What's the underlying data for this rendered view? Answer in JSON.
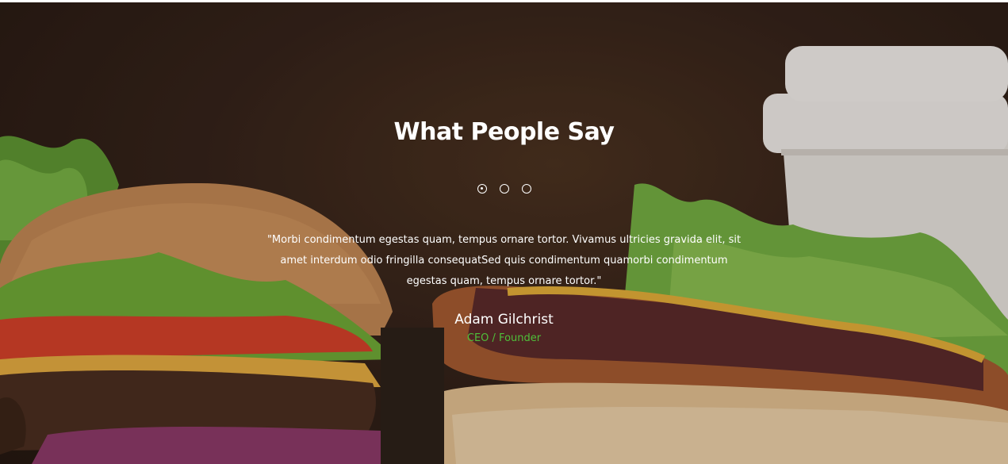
{
  "testimonials": {
    "title": "What People Say",
    "slider_dots": [
      {
        "label": "slide-1",
        "active": true
      },
      {
        "label": "slide-2",
        "active": false
      },
      {
        "label": "slide-3",
        "active": false
      }
    ],
    "quote": "\"Morbi condimentum egestas quam, tempus ornare tortor. Vivamus ultricies gravida elit, sit amet interdum odio fringilla consequatSed quis condimentum quamorbi condimentum egestas quam, tempus ornare tortor.\"",
    "author_name": "Adam Gilchrist",
    "author_role": "CEO / Founder"
  },
  "colors": {
    "background_dark": "#2b1d14",
    "accent_green": "#4fbf3a",
    "text": "#ffffff"
  }
}
